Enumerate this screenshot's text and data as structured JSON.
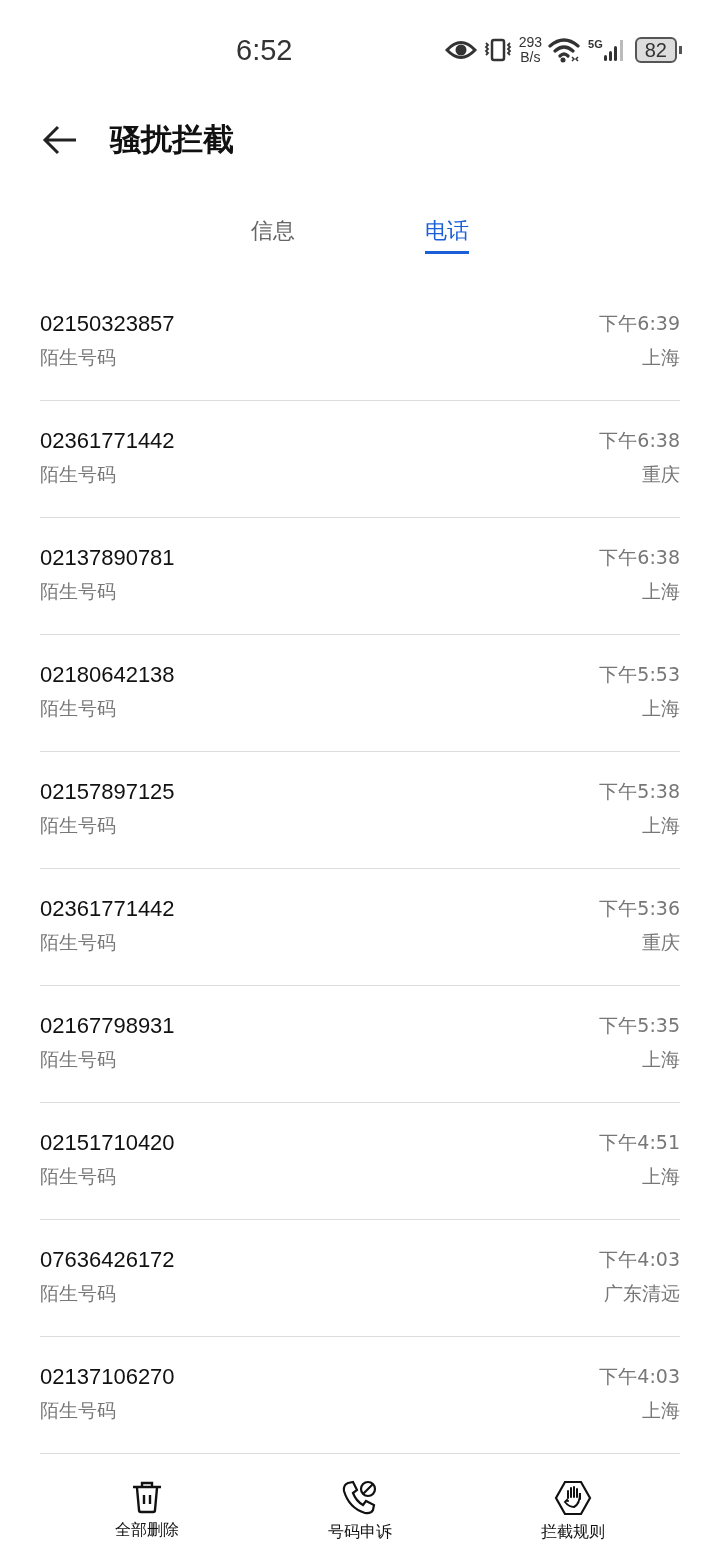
{
  "status_bar": {
    "time": "6:52",
    "net_speed_value": "293",
    "net_speed_unit": "B/s",
    "network": "5G",
    "battery": "82"
  },
  "header": {
    "title": "骚扰拦截"
  },
  "tabs": [
    {
      "label": "信息",
      "selected": false
    },
    {
      "label": "电话",
      "selected": true
    }
  ],
  "calls": [
    {
      "number": "02150323857",
      "label": "陌生号码",
      "time": "下午6:39",
      "location": "上海"
    },
    {
      "number": "02361771442",
      "label": "陌生号码",
      "time": "下午6:38",
      "location": "重庆"
    },
    {
      "number": "02137890781",
      "label": "陌生号码",
      "time": "下午6:38",
      "location": "上海"
    },
    {
      "number": "02180642138",
      "label": "陌生号码",
      "time": "下午5:53",
      "location": "上海"
    },
    {
      "number": "02157897125",
      "label": "陌生号码",
      "time": "下午5:38",
      "location": "上海"
    },
    {
      "number": "02361771442",
      "label": "陌生号码",
      "time": "下午5:36",
      "location": "重庆"
    },
    {
      "number": "02167798931",
      "label": "陌生号码",
      "time": "下午5:35",
      "location": "上海"
    },
    {
      "number": "02151710420",
      "label": "陌生号码",
      "time": "下午4:51",
      "location": "上海"
    },
    {
      "number": "07636426172",
      "label": "陌生号码",
      "time": "下午4:03",
      "location": "广东清远"
    },
    {
      "number": "02137106270",
      "label": "陌生号码",
      "time": "下午4:03",
      "location": "上海"
    }
  ],
  "bottom_bar": [
    {
      "kind": "delete",
      "label": "全部删除"
    },
    {
      "kind": "appeal",
      "label": "号码申诉"
    },
    {
      "kind": "rules",
      "label": "拦截规则"
    }
  ]
}
